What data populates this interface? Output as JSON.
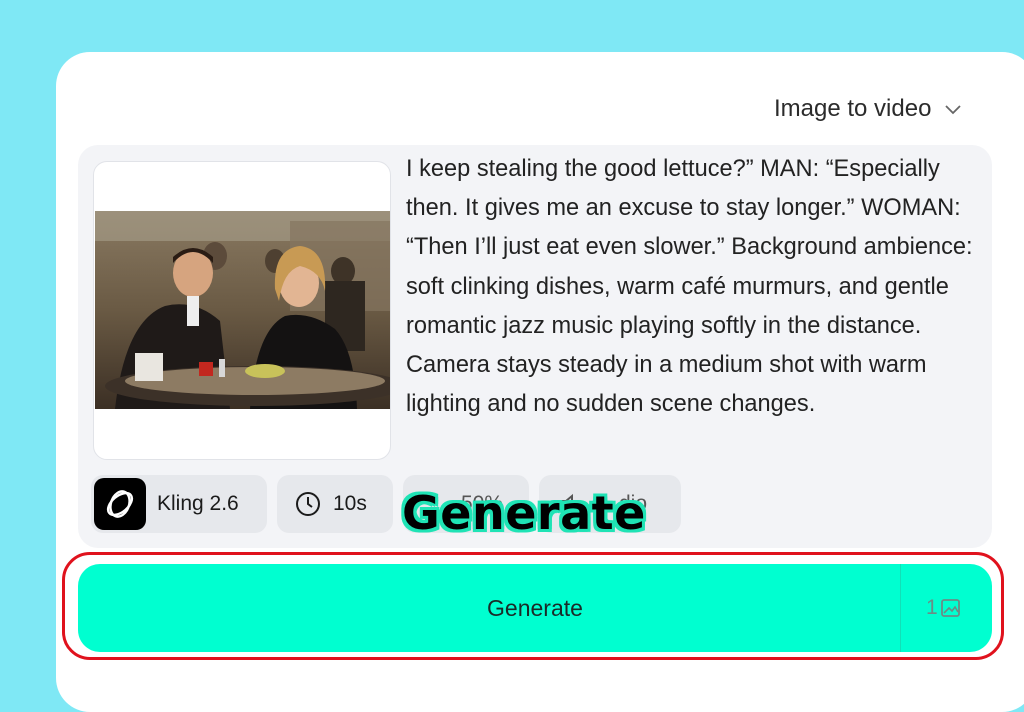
{
  "mode_select": {
    "label": "Image to video"
  },
  "prompt": {
    "text": "I keep stealing the good lettuce?” MAN: “Especially then. It gives me an excuse to stay longer.” WOMAN: “Then I’ll just eat even slower.” Background ambience: soft clinking dishes, warm café murmurs, and gentle romantic jazz music playing softly in the distance. Camera stays steady in a medium shot with warm lighting and no sudden scene changes."
  },
  "chips": {
    "model": "Kling 2.6",
    "duration": "10s",
    "ratio": "50%",
    "audio": "dio"
  },
  "overlay": {
    "label": "Generate"
  },
  "generate_button": {
    "label": "Generate",
    "credit_count": "1"
  },
  "colors": {
    "background": "#7fe8f5",
    "accent": "#00ffd0",
    "highlight_outline": "#e0121d"
  }
}
